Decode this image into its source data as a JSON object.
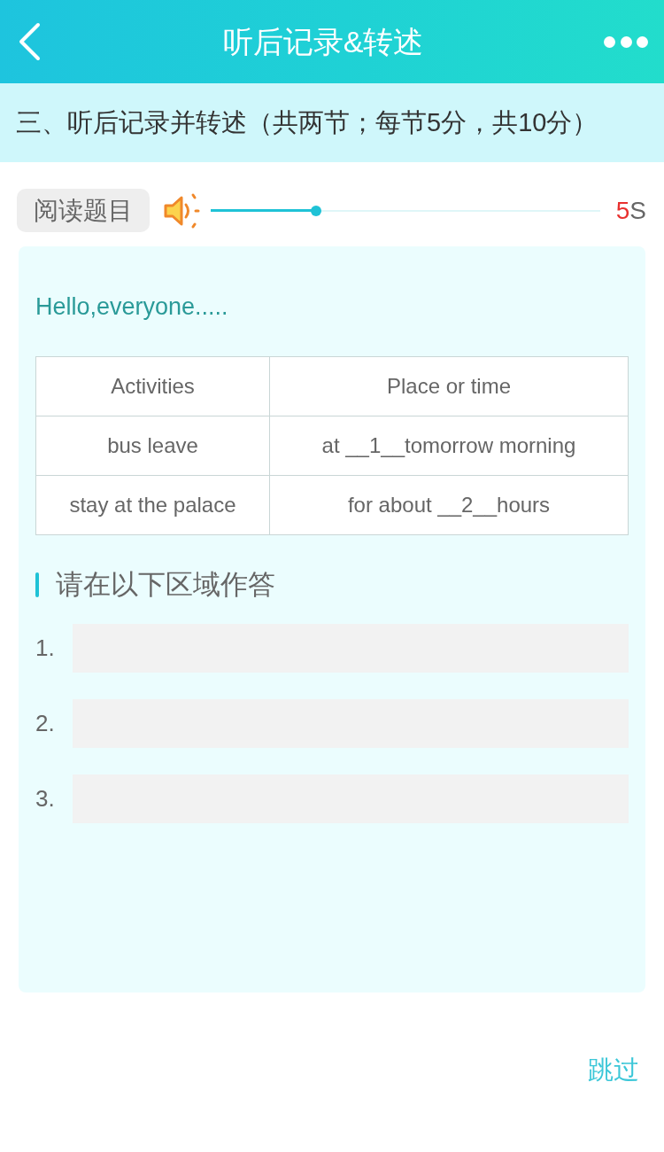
{
  "header": {
    "title": "听后记录&转述"
  },
  "section_heading": "三、听后记录并转述（共两节；每节5分，共10分）",
  "audio": {
    "button": "阅读题目",
    "level": 0.27,
    "countdown": {
      "value": "5",
      "unit": "S"
    }
  },
  "passage": {
    "text": "Hello,everyone.....",
    "table": {
      "columns": [
        "Activities",
        "Place or time"
      ],
      "rows": [
        [
          "bus leave",
          "at __1__tomorrow morning"
        ],
        [
          "stay at the palace",
          "for about __2__hours"
        ]
      ]
    }
  },
  "answer_area": {
    "heading": "请在以下区域作答",
    "answers": [
      {
        "number": "1."
      },
      {
        "number": "2."
      },
      {
        "number": "3."
      }
    ]
  },
  "skip_button": "跳过"
}
